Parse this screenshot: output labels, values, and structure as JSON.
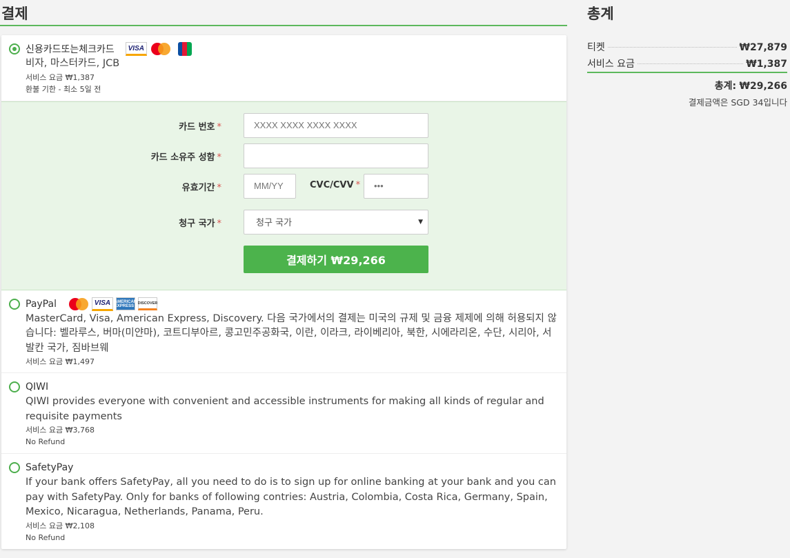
{
  "payment": {
    "title": "결제",
    "methods": [
      {
        "name": "신용카드또는체크카드",
        "desc": "비자, 마스터카드, JCB",
        "fee": "서비스 요금 ₩1,387",
        "refund": "환불 기한 - 최소 5일 전",
        "selected": true
      },
      {
        "name": "PayPal",
        "desc": "MasterCard, Visa, American Express, Discovery. 다음 국가에서의 결제는 미국의 규제 및 금융 제제에 의해 허용되지 않습니다: 벨라루스, 버마(미얀마), 코트디부아르, 콩고민주공화국, 이란, 이라크, 라이베리아, 북한, 시에라리온, 수단, 시리아, 서발칸 국가, 짐바브웨",
        "fee": "서비스 요금 ₩1,497"
      },
      {
        "name": "QIWI",
        "desc": "QIWI provides everyone with convenient and accessible instruments for making all kinds of regular and requisite payments",
        "fee": "서비스 요금 ₩3,768",
        "refund": "No Refund"
      },
      {
        "name": "SafetyPay",
        "desc": "If your bank offers SafetyPay, all you need to do is to sign up for online banking at your bank and you can pay with SafetyPay. Only for banks of following contries: Austria, Colombia, Costa Rica, Germany, Spain, Mexico, Nicaragua, Netherlands, Panama, Peru.",
        "fee": "서비스 요금 ₩2,108",
        "refund": "No Refund"
      }
    ],
    "form": {
      "card_number_label": "카드 번호",
      "card_number_placeholder": "XXXX XXXX XXXX XXXX",
      "holder_label": "카드 소유주 성함",
      "expiry_label": "유효기간",
      "expiry_placeholder": "MM/YY",
      "cvc_label": "CVC/CVV",
      "cvc_placeholder": "•••",
      "country_label": "청구 국가",
      "country_value": "청구 국가",
      "required_mark": "*",
      "pay_button": "결제하기 ₩29,266"
    },
    "logo_text": {
      "visa": "VISA",
      "amex": "AMERICAN EXPRESS",
      "discover": "DISCOVER"
    }
  },
  "summary": {
    "title": "총계",
    "rows": [
      {
        "label": "티켓",
        "value": "₩27,879"
      },
      {
        "label": "서비스 요금",
        "value": "₩1,387"
      }
    ],
    "total_label": "총계:",
    "total_value": "₩29,266",
    "note": "결제금액은 SGD 34입니다"
  },
  "colors": {
    "accent": "#4cb34c",
    "form_bg": "#e9f5e7",
    "required": "#d9534f"
  }
}
